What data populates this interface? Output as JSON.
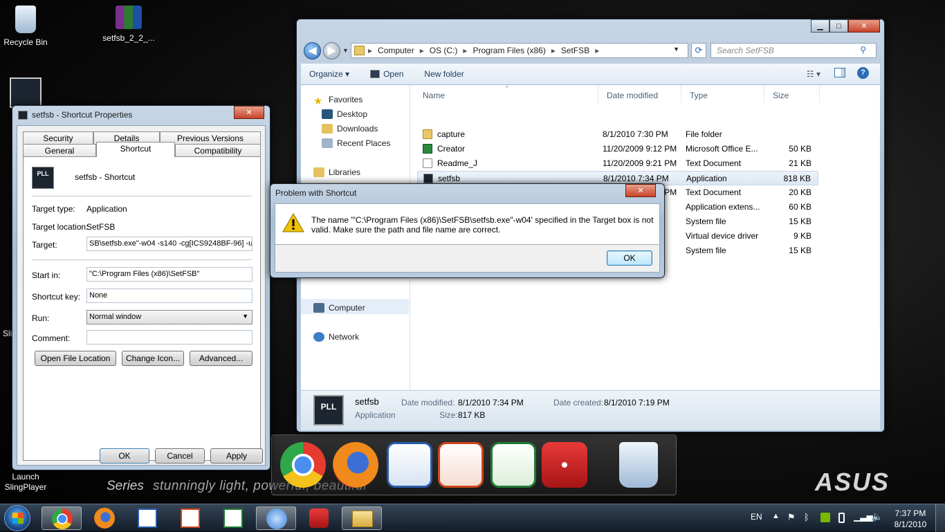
{
  "desktop": {
    "icons": [
      {
        "label": "Recycle Bin",
        "icon": "recycle-bin-icon"
      },
      {
        "label": "setfsb_2_2_...",
        "icon": "winrar-archive-icon"
      },
      {
        "label": "Sli",
        "icon": "app-icon"
      },
      {
        "label": "Launch SlingPlayer",
        "icon": "app-icon"
      }
    ],
    "wallpaper_text": "stunningly light, powerful, beautiful",
    "series_text": "Series",
    "brand": "ASUS"
  },
  "explorer": {
    "breadcrumb": [
      "Computer",
      "OS (C:)",
      "Program Files (x86)",
      "SetFSB"
    ],
    "search_placeholder": "Search SetFSB",
    "toolbar": {
      "organize": "Organize",
      "open": "Open",
      "new_folder": "New folder"
    },
    "nav": {
      "favorites": "Favorites",
      "desktop": "Desktop",
      "downloads": "Downloads",
      "recent": "Recent Places",
      "libraries": "Libraries",
      "computer": "Computer",
      "network": "Network"
    },
    "columns": {
      "name": "Name",
      "date": "Date modified",
      "type": "Type",
      "size": "Size"
    },
    "files": [
      {
        "name": "capture",
        "date": "8/1/2010 7:30 PM",
        "type": "File folder",
        "size": ""
      },
      {
        "name": "Creator",
        "date": "11/20/2009 9:12 PM",
        "type": "Microsoft Office E...",
        "size": "50 KB"
      },
      {
        "name": "Readme_J",
        "date": "11/20/2009 9:21 PM",
        "type": "Text Document",
        "size": "21 KB"
      },
      {
        "name": "setfsb",
        "date": "8/1/2010 7:34 PM",
        "type": "Application",
        "size": "818 KB"
      },
      {
        "name": "setfsb",
        "date": "11/20/2009 9:16 PM",
        "type": "Text Document",
        "size": "20 KB"
      },
      {
        "name": "",
        "date": "",
        "type": "Application extens...",
        "size": "60 KB"
      },
      {
        "name": "",
        "date": "",
        "type": "System file",
        "size": "15 KB"
      },
      {
        "name": "",
        "date": "",
        "type": "Virtual device driver",
        "size": "9 KB"
      },
      {
        "name": "",
        "date": "",
        "type": "System file",
        "size": "15 KB"
      }
    ],
    "details": {
      "name": "setfsb",
      "kind": "Application",
      "modified_label": "Date modified:",
      "modified": "8/1/2010 7:34 PM",
      "created_label": "Date created:",
      "created": "8/1/2010 7:19 PM",
      "size_label": "Size:",
      "size": "817 KB"
    }
  },
  "props": {
    "title": "setfsb - Shortcut Properties",
    "tabs_top": [
      "Security",
      "Details",
      "Previous Versions"
    ],
    "tabs_bottom": [
      "General",
      "Shortcut",
      "Compatibility"
    ],
    "shortcut_name": "setfsb - Shortcut",
    "target_type_label": "Target type:",
    "target_type": "Application",
    "target_location_label": "Target location:",
    "target_location": "SetFSB",
    "target_label": "Target:",
    "target": "SB\\setfsb.exe\"-w04 -s140 -cg[ICS9248BF-96] -u1",
    "start_in_label": "Start in:",
    "start_in": "\"C:\\Program Files (x86)\\SetFSB\"",
    "shortcut_key_label": "Shortcut key:",
    "shortcut_key": "None",
    "run_label": "Run:",
    "run": "Normal window",
    "comment_label": "Comment:",
    "comment": "",
    "open_location": "Open File Location",
    "change_icon": "Change Icon...",
    "advanced": "Advanced...",
    "ok": "OK",
    "cancel": "Cancel",
    "apply": "Apply",
    "icon_text": "PLL"
  },
  "error": {
    "title": "Problem with Shortcut",
    "message": "The name '\"C:\\Program Files (x86)\\SetFSB\\setfsb.exe\"-w04' specified in the Target box is not valid. Make sure the path and file name are correct.",
    "ok": "OK"
  },
  "tray": {
    "lang": "EN",
    "time": "7:37 PM",
    "date": "8/1/2010"
  },
  "colors": {
    "accent": "#3c7fb1",
    "error_red": "#c7442a",
    "warning": "#f2c200"
  }
}
